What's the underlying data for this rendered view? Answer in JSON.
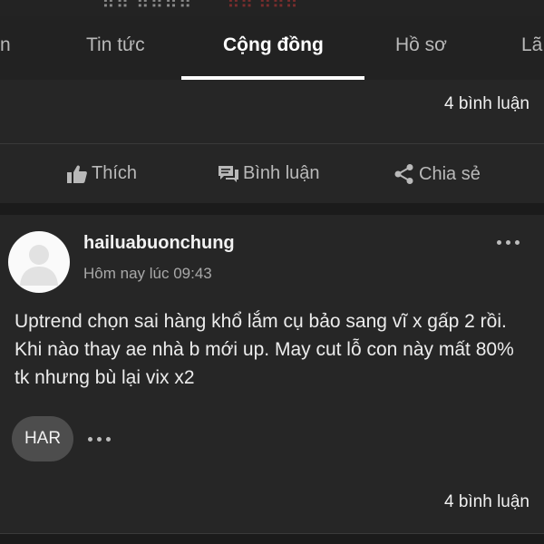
{
  "tabs": [
    {
      "label": "n"
    },
    {
      "label": "Tin tức"
    },
    {
      "label": "Cộng đồng",
      "active": true
    },
    {
      "label": "Hồ sơ"
    },
    {
      "label": "Lã"
    }
  ],
  "post1": {
    "comments_count": "4 bình luận",
    "actions": {
      "like": "Thích",
      "comment": "Bình luận",
      "share": "Chia sẻ"
    }
  },
  "post2": {
    "username": "hailuabuonchung",
    "timestamp": "Hôm nay lúc 09:43",
    "body": "Uptrend chọn sai hàng khổ lắm cụ bảo sang vĩ x gấp 2 rồi. Khi nào thay ae nhà b mới up. May cut lỗ con này mất 80% tk nhưng bù lại vix x2",
    "tag": "HAR",
    "comments_count": "4 bình luận"
  },
  "colors": {
    "background": "#1b1b1b",
    "card": "#262626",
    "active_tab": "#ffffff",
    "inactive": "#b9b9b9",
    "tag_pill": "#4d4d4d"
  }
}
